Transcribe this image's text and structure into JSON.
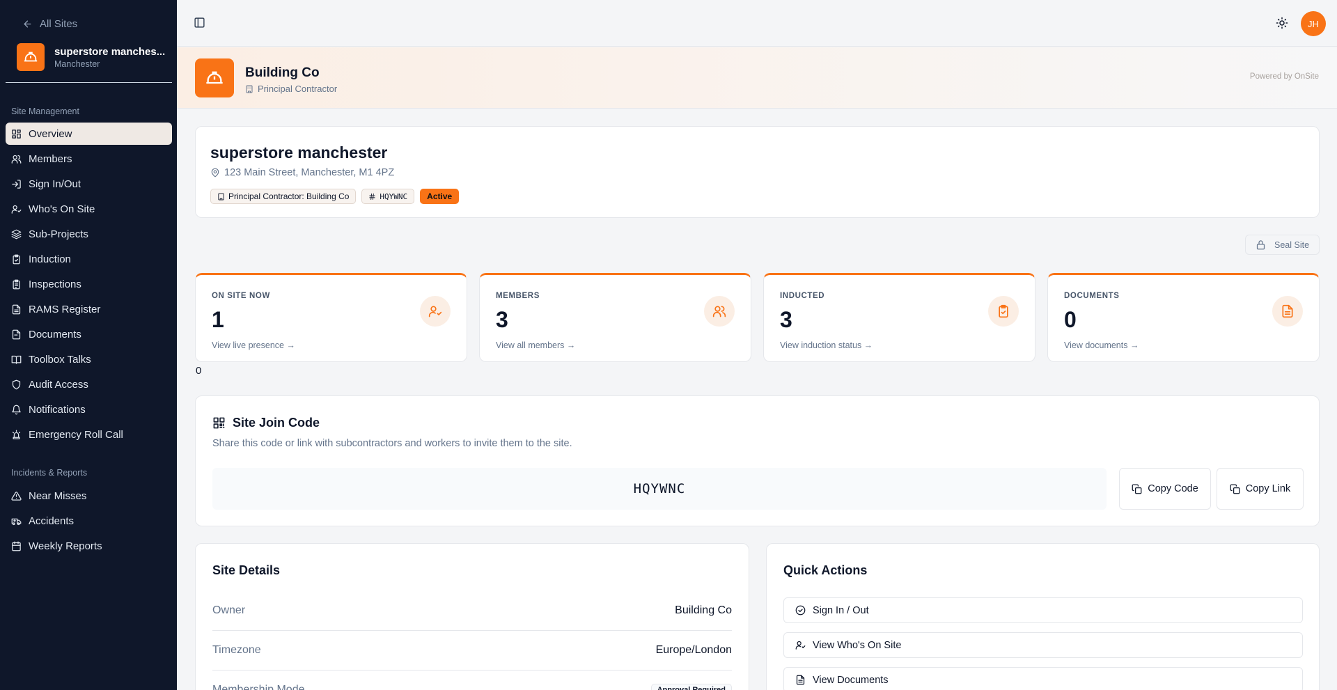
{
  "sidebar": {
    "back_label": "All Sites",
    "site_name": "superstore manches...",
    "site_city": "Manchester",
    "section1": "Site Management",
    "section1_items": [
      {
        "label": "Overview",
        "icon": "grid-icon"
      },
      {
        "label": "Members",
        "icon": "users-icon"
      },
      {
        "label": "Sign In/Out",
        "icon": "sign-in-icon"
      },
      {
        "label": "Who's On Site",
        "icon": "user-check-icon"
      },
      {
        "label": "Sub-Projects",
        "icon": "layers-icon"
      },
      {
        "label": "Induction",
        "icon": "clipboard-check-icon"
      },
      {
        "label": "Inspections",
        "icon": "clipboard-list-icon"
      },
      {
        "label": "RAMS Register",
        "icon": "file-text-icon"
      },
      {
        "label": "Documents",
        "icon": "file-icon"
      },
      {
        "label": "Toolbox Talks",
        "icon": "book-icon"
      },
      {
        "label": "Audit Access",
        "icon": "shield-icon"
      },
      {
        "label": "Notifications",
        "icon": "bell-icon"
      },
      {
        "label": "Emergency Roll Call",
        "icon": "siren-icon"
      }
    ],
    "section2": "Incidents & Reports",
    "section2_items": [
      {
        "label": "Near Misses",
        "icon": "alert-triangle-icon"
      },
      {
        "label": "Accidents",
        "icon": "ambulance-icon"
      },
      {
        "label": "Weekly Reports",
        "icon": "calendar-icon"
      }
    ]
  },
  "topbar": {
    "avatar_initials": "JH"
  },
  "banner": {
    "company": "Building Co",
    "role": "Principal Contractor",
    "powered": "Powered by OnSite"
  },
  "site": {
    "name": "superstore manchester",
    "address": "123 Main Street, Manchester, M1 4PZ",
    "tag_contractor": "Principal Contractor: Building Co",
    "tag_code": "HQYWNC",
    "tag_status": "Active"
  },
  "seal_label": "Seal Site",
  "stats": [
    {
      "label": "ON SITE NOW",
      "value": "1",
      "link": "View live presence →"
    },
    {
      "label": "MEMBERS",
      "value": "3",
      "link": "View all members →"
    },
    {
      "label": "INDUCTED",
      "value": "3",
      "link": "View induction status →"
    },
    {
      "label": "DOCUMENTS",
      "value": "0",
      "link": "View documents →"
    }
  ],
  "stray_value": "0",
  "join": {
    "title": "Site Join Code",
    "desc": "Share this code or link with subcontractors and workers to invite them to the site.",
    "code": "HQYWNC",
    "copy_code": "Copy Code",
    "copy_link": "Copy Link"
  },
  "details": {
    "title": "Site Details",
    "rows": [
      {
        "key": "Owner",
        "value": "Building Co"
      },
      {
        "key": "Timezone",
        "value": "Europe/London"
      },
      {
        "key": "Membership Mode",
        "value": "Approval Required"
      }
    ]
  },
  "quick": {
    "title": "Quick Actions",
    "items": [
      "Sign In / Out",
      "View Who's On Site",
      "View Documents"
    ]
  },
  "colors": {
    "accent": "#f97316",
    "sidebar": "#0f172a"
  }
}
